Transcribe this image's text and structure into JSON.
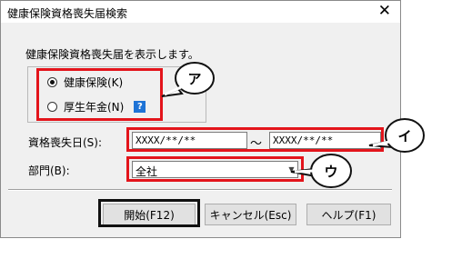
{
  "window": {
    "title": "健康保険資格喪失届検索",
    "close_icon": "close-icon"
  },
  "description": "健康保険資格喪失届を表示します。",
  "insurance_type": {
    "options": [
      {
        "label": "健康保険(K)",
        "selected": true
      },
      {
        "label": "厚生年金(N)",
        "selected": false
      }
    ],
    "help_badge": "?"
  },
  "date_range": {
    "label": "資格喪失日(S):",
    "from_value": "XXXX/**/**",
    "separator": "～",
    "to_value": "XXXX/**/**"
  },
  "department": {
    "label": "部門(B):",
    "value": "全社",
    "arrow_icon": "dropdown-arrow-icon"
  },
  "buttons": {
    "start": "開始(F12)",
    "cancel": "キャンセル(Esc)",
    "help": "ヘルプ(F1)"
  },
  "callouts": {
    "a": "ア",
    "i": "イ",
    "u": "ウ"
  },
  "colors": {
    "highlight_red": "#e3141b",
    "highlight_black": "#111111",
    "help_blue": "#1e73d6"
  }
}
